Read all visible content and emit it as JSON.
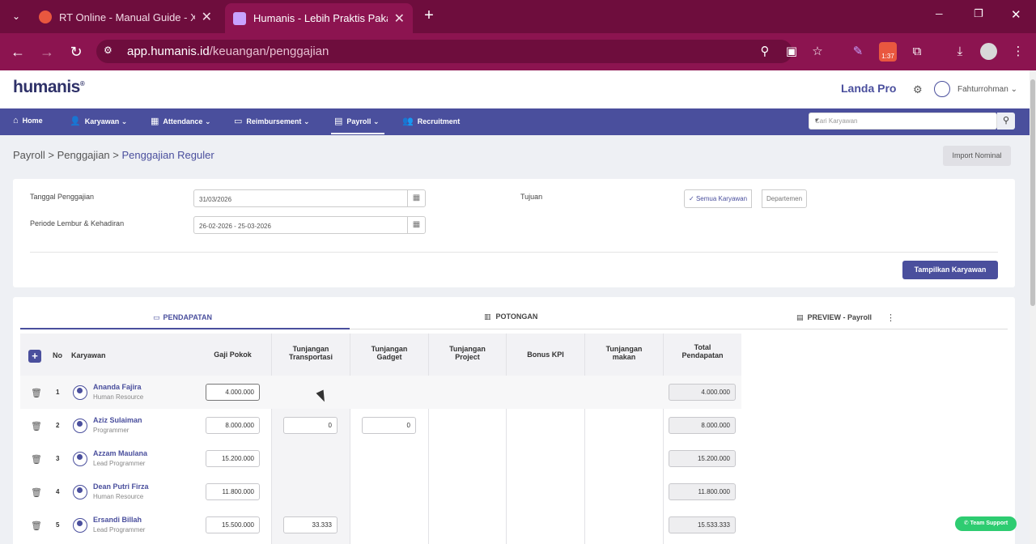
{
  "browser": {
    "tabs": [
      {
        "title": "RT Online - Manual Guide - Xm",
        "close": "✕"
      },
      {
        "title": "Humanis - Lebih Praktis Pakai H",
        "close": "✕"
      }
    ],
    "new_tab": "+",
    "url_domain": "app.humanis.id",
    "url_path": "/keuangan/penggajian",
    "extension_badge": "1:37",
    "window_controls": [
      "─",
      "❐",
      "✕"
    ]
  },
  "app": {
    "logo": "humanis",
    "company": "Landa Pro",
    "user": "Fahturrohman",
    "nav": [
      {
        "label": "Home",
        "icon": "home-icon"
      },
      {
        "label": "Karyawan",
        "icon": "user-edit-icon"
      },
      {
        "label": "Attendance",
        "icon": "calendar-icon"
      },
      {
        "label": "Reimbursement",
        "icon": "money-icon"
      },
      {
        "label": "Payroll",
        "icon": "wallet-icon"
      },
      {
        "label": "Recruitment",
        "icon": "users-icon"
      }
    ],
    "search_placeholder": "Cari Karyawan"
  },
  "breadcrumb": {
    "items": [
      "Payroll",
      "Penggajian",
      "Penggajian Reguler"
    ],
    "separator": ">"
  },
  "import_button": "Import Nominal",
  "form": {
    "tanggal_label": "Tanggal Penggajian",
    "tanggal_value": "31/03/2026",
    "periode_label": "Periode Lembur & Kehadiran",
    "periode_value": "26-02-2026 - 25-03-2026",
    "tujuan_label": "Tujuan",
    "tujuan_options": [
      "Semua Karyawan",
      "Departemen"
    ],
    "tujuan_selected": "Semua Karyawan",
    "show_button": "Tampilkan Karyawan"
  },
  "tabs": [
    {
      "label": "PENDAPATAN",
      "active": true
    },
    {
      "label": "POTONGAN",
      "active": false
    },
    {
      "label": "PREVIEW - Payroll",
      "active": false
    }
  ],
  "table": {
    "headers": {
      "no": "No",
      "karyawan": "Karyawan",
      "gaji_pokok": "Gaji Pokok",
      "tunj_transport_1": "Tunjangan",
      "tunj_transport_2": "Transportasi",
      "tunj_gadget_1": "Tunjangan",
      "tunj_gadget_2": "Gadget",
      "tunj_project_1": "Tunjangan",
      "tunj_project_2": "Project",
      "bonus_kpi": "Bonus KPI",
      "tunj_makan_1": "Tunjangan",
      "tunj_makan_2": "makan",
      "total_1": "Total",
      "total_2": "Pendapatan"
    },
    "rows": [
      {
        "no": "1",
        "name": "Ananda Fajira",
        "role": "Human Resource",
        "gaji": "4.000.000",
        "transport": "",
        "gadget": "",
        "total": "4.000.000"
      },
      {
        "no": "2",
        "name": "Aziz Sulaiman",
        "role": "Programmer",
        "gaji": "8.000.000",
        "transport": "0",
        "gadget": "0",
        "total": "8.000.000"
      },
      {
        "no": "3",
        "name": "Azzam Maulana",
        "role": "Lead Programmer",
        "gaji": "15.200.000",
        "transport": "",
        "gadget": "",
        "total": "15.200.000"
      },
      {
        "no": "4",
        "name": "Dean Putri Firza",
        "role": "Human Resource",
        "gaji": "11.800.000",
        "transport": "",
        "gadget": "",
        "total": "11.800.000"
      },
      {
        "no": "5",
        "name": "Ersandi Billah",
        "role": "Lead Programmer",
        "gaji": "15.500.000",
        "transport": "33.333",
        "gadget": "",
        "total": "15.533.333"
      }
    ]
  },
  "support_button": "Team Support",
  "colors": {
    "primary": "#4a4f9d",
    "chrome": "#8c1450",
    "success": "#2ecc71"
  }
}
